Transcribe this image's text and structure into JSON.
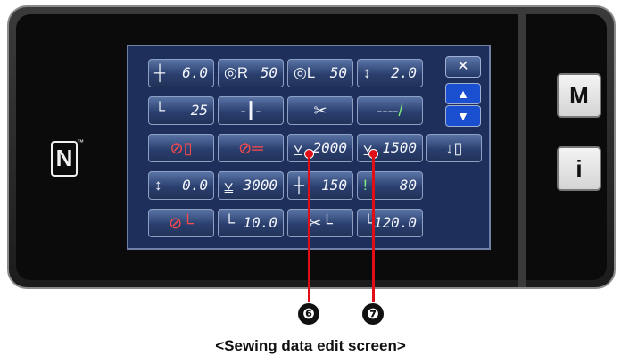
{
  "rows": [
    [
      {
        "icon": "┼",
        "value": "6.0"
      },
      {
        "icon": "◎R",
        "value": "50"
      },
      {
        "icon": "◎L",
        "value": "50"
      },
      {
        "icon": "↕",
        "value": "2.0"
      }
    ],
    [
      {
        "icon": "└",
        "value": "25"
      },
      {
        "icon": "‑┃‑",
        "value": ""
      },
      {
        "icon": "✂",
        "value": ""
      },
      {
        "icon": "‑‑‑‑✓",
        "value": ""
      }
    ],
    [
      {
        "icon": "⊘▯",
        "value": ""
      },
      {
        "icon": "⊘═",
        "value": ""
      },
      {
        "icon": "⩣",
        "value": "2000"
      },
      {
        "icon": "⩣",
        "value": "1500"
      },
      {
        "icon": "↓▯",
        "value": ""
      }
    ],
    [
      {
        "icon": "↕",
        "value": "0.0"
      },
      {
        "icon": "⩣",
        "value": "3000"
      },
      {
        "icon": "┼",
        "value": "150"
      },
      {
        "icon": "!",
        "value": "80"
      }
    ],
    [
      {
        "icon": "⊘└",
        "value": ""
      },
      {
        "icon": "└",
        "value": "10.0"
      },
      {
        "icon": "✂└",
        "value": ""
      },
      {
        "icon": "└",
        "value": "120.0"
      }
    ]
  ],
  "side_buttons": {
    "mode": "M",
    "info": "i"
  },
  "nav": {
    "close": "✕",
    "up": "▲",
    "down": "▼"
  },
  "nfc_logo": "N",
  "markers": [
    "❻",
    "❼"
  ],
  "caption": "<Sewing data edit screen>"
}
